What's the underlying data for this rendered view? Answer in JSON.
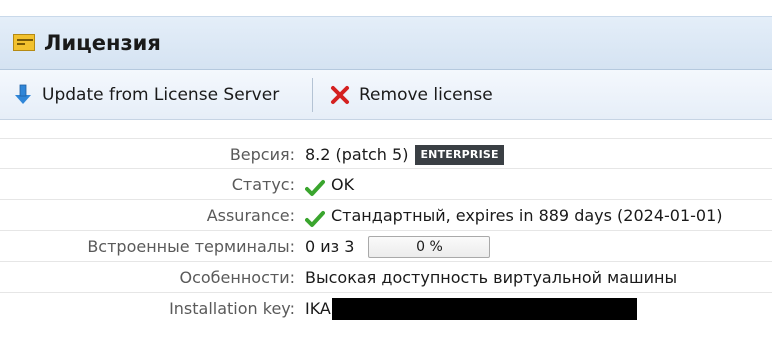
{
  "header": {
    "title": "Лицензия",
    "icon": "license-icon",
    "icon_color": "#f2c12e"
  },
  "toolbar": {
    "update_label": "Update from License Server",
    "update_icon": "arrow-down-icon",
    "remove_label": "Remove license",
    "remove_icon": "red-x-icon"
  },
  "details": {
    "version": {
      "label": "Версия:",
      "value": "8.2 (patch 5)",
      "badge": "ENTERPRISE"
    },
    "status": {
      "label": "Статус:",
      "value": "OK",
      "icon": "check-icon"
    },
    "assurance": {
      "label": "Assurance:",
      "value": "Стандартный, expires in 889 days (2024-01-01)",
      "icon": "check-icon"
    },
    "terminals": {
      "label": "Встроенные терминалы:",
      "value": "0 из 3",
      "progress_text": "0 %",
      "progress_fraction": 0
    },
    "features": {
      "label": "Особенности:",
      "value": "Высокая доступность виртуальной машины"
    },
    "installation_key": {
      "label": "Installation key:",
      "value": "IKA"
    }
  },
  "colors": {
    "header_bg": "#d5e3f2",
    "accent_blue": "#2f86d8",
    "remove_red": "#d42020",
    "check_green": "#3aa52e",
    "badge_bg": "#3a3f44"
  }
}
